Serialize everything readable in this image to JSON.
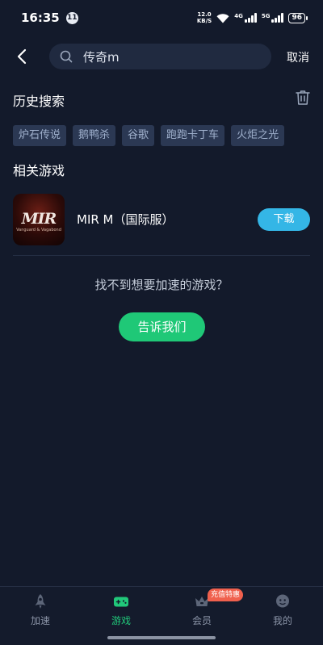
{
  "status": {
    "time": "16:35",
    "notification_count": "11",
    "net_speed_value": "12.0",
    "net_speed_unit": "KB/S",
    "signal1_label": "4G",
    "signal2_label": "5G",
    "battery": "96"
  },
  "search": {
    "query": "传奇m",
    "cancel_label": "取消"
  },
  "history": {
    "title": "历史搜索",
    "tags": [
      "炉石传说",
      "鹅鸭杀",
      "谷歌",
      "跑跑卡丁车",
      "火炬之光"
    ]
  },
  "related": {
    "title": "相关游戏",
    "games": [
      {
        "name": "MIR M（国际服）",
        "icon_logo": "MIR",
        "icon_sub": "Vanguard & Vagabond",
        "button": "下载"
      }
    ]
  },
  "not_found": {
    "text": "找不到想要加速的游戏？",
    "button": "告诉我们"
  },
  "tabbar": {
    "tabs": [
      {
        "label": "加速",
        "icon": "rocket-icon"
      },
      {
        "label": "游戏",
        "icon": "gamepad-icon"
      },
      {
        "label": "会员",
        "icon": "crown-icon"
      },
      {
        "label": "我的",
        "icon": "profile-icon"
      }
    ],
    "promo_badge": "充值特惠",
    "active_index": 1
  },
  "colors": {
    "background": "#131a2b",
    "accent_green": "#1fc877",
    "download_blue": "#34b6e6",
    "promo_red": "#f0604d"
  }
}
